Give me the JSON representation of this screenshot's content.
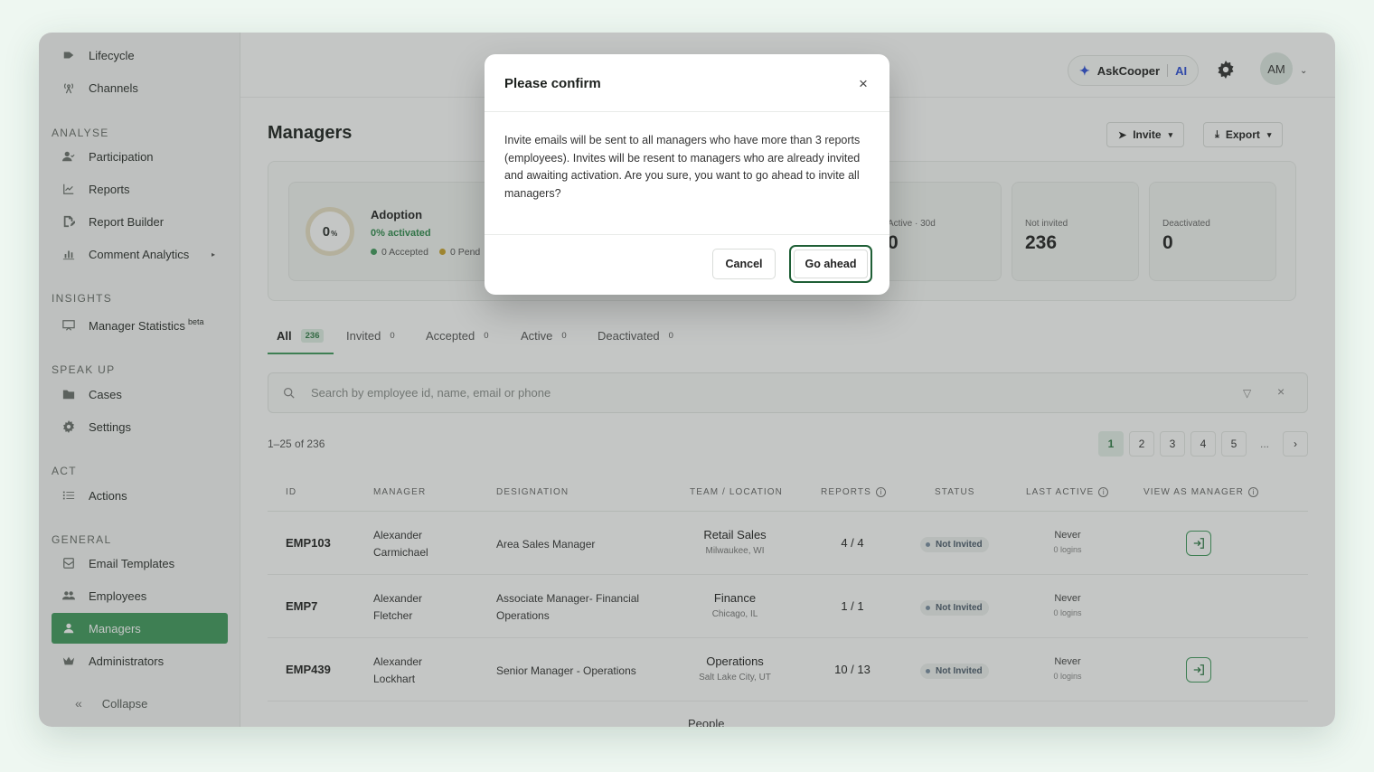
{
  "sidebar": {
    "items_top": [
      {
        "label": "Lifecycle",
        "icon": "lifecycle-icon"
      },
      {
        "label": "Channels",
        "icon": "broadcast-icon"
      }
    ],
    "sections": {
      "analyse": "ANALYSE",
      "insights": "INSIGHTS",
      "speak_up": "SPEAK UP",
      "act": "ACT",
      "general": "GENERAL"
    },
    "analyse_items": [
      "Participation",
      "Reports",
      "Report Builder",
      "Comment Analytics"
    ],
    "insights_items": [
      {
        "label": "Manager Statistics",
        "sup": "beta"
      }
    ],
    "speak_up_items": [
      "Cases",
      "Settings"
    ],
    "act_items": [
      "Actions"
    ],
    "general_items": [
      "Email Templates",
      "Employees",
      "Managers",
      "Administrators"
    ],
    "active": "Managers",
    "collapse_label": "Collapse"
  },
  "header": {
    "askcooper_label": "AskCooper",
    "ai_label": "AI",
    "avatar_initials": "AM"
  },
  "page": {
    "title": "Managers",
    "invite_label": "Invite",
    "export_label": "Export"
  },
  "stats": {
    "adoption_value": "0",
    "adoption_unit": "%",
    "adoption_title": "Adoption",
    "adoption_sub": "0% activated",
    "legend_accepted": "0 Accepted",
    "legend_pending": "0 Pend",
    "cards": [
      {
        "label": "Active · 30d",
        "value": "0"
      },
      {
        "label": "Not invited",
        "value": "236"
      },
      {
        "label": "Deactivated",
        "value": "0"
      }
    ],
    "colors": {
      "accepted": "#3f9a5c",
      "pending": "#c9a22a"
    }
  },
  "tabs": [
    {
      "label": "All",
      "count": "236"
    },
    {
      "label": "Invited",
      "count": "0"
    },
    {
      "label": "Accepted",
      "count": "0"
    },
    {
      "label": "Active",
      "count": "0"
    },
    {
      "label": "Deactivated",
      "count": "0"
    }
  ],
  "search": {
    "placeholder": "Search by employee id, name, email or phone"
  },
  "pagination": {
    "range": "1–25 of 236",
    "pages": [
      "1",
      "2",
      "3",
      "4",
      "5",
      "..."
    ],
    "next": "›"
  },
  "table": {
    "headers": [
      "ID",
      "MANAGER",
      "DESIGNATION",
      "TEAM / LOCATION",
      "REPORTS",
      "STATUS",
      "LAST ACTIVE",
      "VIEW AS MANAGER"
    ],
    "rows": [
      {
        "id": "EMP103",
        "manager_first": "Alexander",
        "manager_last": "Carmichael",
        "designation": "Area Sales Manager",
        "team": "Retail Sales",
        "location": "Milwaukee, WI",
        "reports": "4 / 4",
        "status": "Not Invited",
        "last_active": "Never",
        "logins": "0 logins",
        "view": true
      },
      {
        "id": "EMP7",
        "manager_first": "Alexander",
        "manager_last": "Fletcher",
        "designation": "Associate Manager- Financial Operations",
        "team": "Finance",
        "location": "Chicago, IL",
        "reports": "1 / 1",
        "status": "Not Invited",
        "last_active": "Never",
        "logins": "0 logins",
        "view": false
      },
      {
        "id": "EMP439",
        "manager_first": "Alexander",
        "manager_last": "Lockhart",
        "designation": "Senior Manager - Operations",
        "team": "Operations",
        "location": "Salt Lake City, UT",
        "reports": "10 / 13",
        "status": "Not Invited",
        "last_active": "Never",
        "logins": "0 logins",
        "view": true
      }
    ],
    "partial_next": "People"
  },
  "modal": {
    "title": "Please confirm",
    "body": "Invite emails will be sent to all managers who have more than 3 reports (employees). Invites will be resent to managers who are already invited and awaiting activation. Are you sure, you want to go ahead to invite all managers?",
    "cancel_label": "Cancel",
    "confirm_label": "Go ahead",
    "close_glyph": "×"
  },
  "colors": {
    "brand": "#3f9a5c",
    "brand_dark": "#1f5f36",
    "ai_blue": "#2e4fd8"
  }
}
